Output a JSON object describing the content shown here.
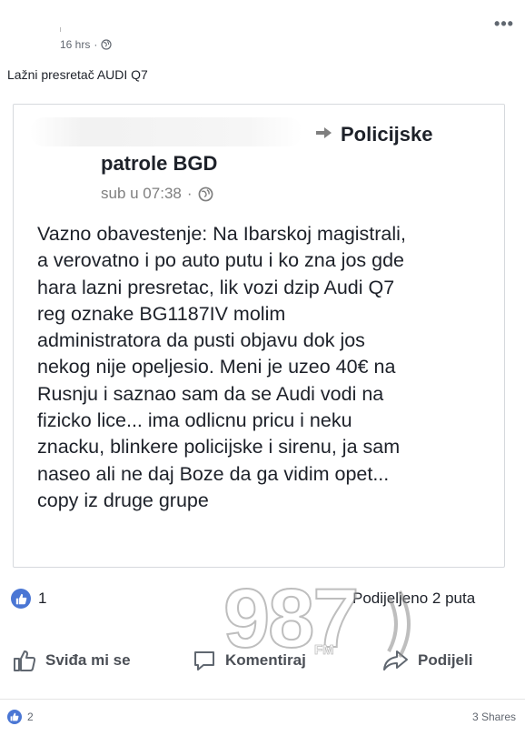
{
  "post": {
    "time": "16 hrs",
    "separator": "·",
    "privacy_icon": "globe-icon",
    "more_icon": "more-options-icon",
    "text": "Lažni presretač AUDI Q7"
  },
  "shared": {
    "group_name_line1": "Policijske",
    "group_name_line2": "patrole BGD",
    "time": "sub u 07:38",
    "separator": "·",
    "privacy_icon": "globe-icon",
    "body": "Vazno obavestenje: Na Ibarskoj magistrali,\na verovatno i po auto putu i ko zna jos gde\nhara lazni presretac, lik vozi dzip Audi Q7\nreg oznake BG1187IV  molim\nadministratora da pusti objavu dok jos\nnekog nije opeljesio. Meni je uzeo 40€ na\nRusnju i saznao sam da se Audi vodi na\nfizicko lice... ima odlicnu pricu i neku\nznacku, blinkere policijske i sirenu, ja sam\nnaseo ali ne daj Boze da ga vidim opet...\ncopy iz druge grupe"
  },
  "shared_reactions": {
    "like_count": "1",
    "shares_text": "Podijeljeno 2 puta"
  },
  "actions": {
    "like_label": "Sviđa mi se",
    "comment_label": "Komentiraj",
    "share_label": "Podijeli"
  },
  "footer": {
    "like_count": "2",
    "shares_text": "3 Shares"
  },
  "watermark": {
    "number": "987",
    "suffix": "FM"
  },
  "colors": {
    "like_blue": "#4a76d4",
    "text_dark": "#1d2129",
    "muted": "#616770"
  }
}
